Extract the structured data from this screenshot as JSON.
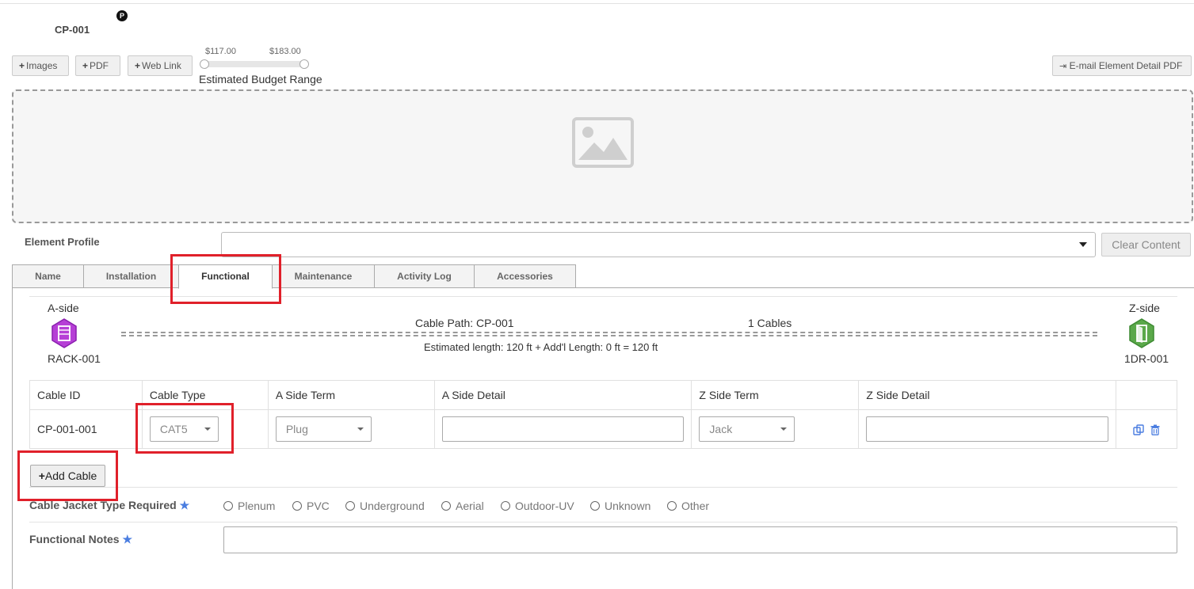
{
  "header": {
    "element_id": "CP-001",
    "badge": "P"
  },
  "toolbar": {
    "images_label": "Images",
    "pdf_label": "PDF",
    "weblink_label": "Web Link",
    "email_pdf_label": "E-mail Element Detail PDF"
  },
  "budget": {
    "min_label": "$117.00",
    "max_label": "$183.00",
    "label": "Estimated Budget Range"
  },
  "profile": {
    "label": "Element Profile",
    "selected": "",
    "clear_label": "Clear Content"
  },
  "tabs": [
    {
      "label": "Name"
    },
    {
      "label": "Installation"
    },
    {
      "label": "Functional",
      "active": true
    },
    {
      "label": "Maintenance"
    },
    {
      "label": "Activity Log"
    },
    {
      "label": "Accessories"
    }
  ],
  "functional": {
    "a_side": {
      "label": "A-side",
      "name": "RACK-001",
      "color": "#b63fd6"
    },
    "z_side": {
      "label": "Z-side",
      "name": "1DR-001",
      "color": "#5aa84a"
    },
    "cable_path": "Cable Path: CP-001",
    "cable_count": "1 Cables",
    "estimated_length": "Estimated length: 120 ft + Add'l Length: 0 ft  =  120 ft",
    "table": {
      "headers": [
        "Cable ID",
        "Cable Type",
        "A Side Term",
        "A Side Detail",
        "Z Side Term",
        "Z Side Detail",
        ""
      ],
      "rows": [
        {
          "cable_id": "CP-001-001",
          "cable_type": "CAT5",
          "a_side_term": "Plug",
          "a_side_detail": "",
          "z_side_term": "Jack",
          "z_side_detail": ""
        }
      ]
    },
    "add_cable_label": "Add Cable",
    "jacket": {
      "label": "Cable Jacket Type Required",
      "options": [
        "Plenum",
        "PVC",
        "Underground",
        "Aerial",
        "Outdoor-UV",
        "Unknown",
        "Other"
      ]
    },
    "notes": {
      "label": "Functional Notes",
      "value": ""
    }
  },
  "colors": {
    "highlight": "#e0202a",
    "required_star": "#4a7de0"
  }
}
